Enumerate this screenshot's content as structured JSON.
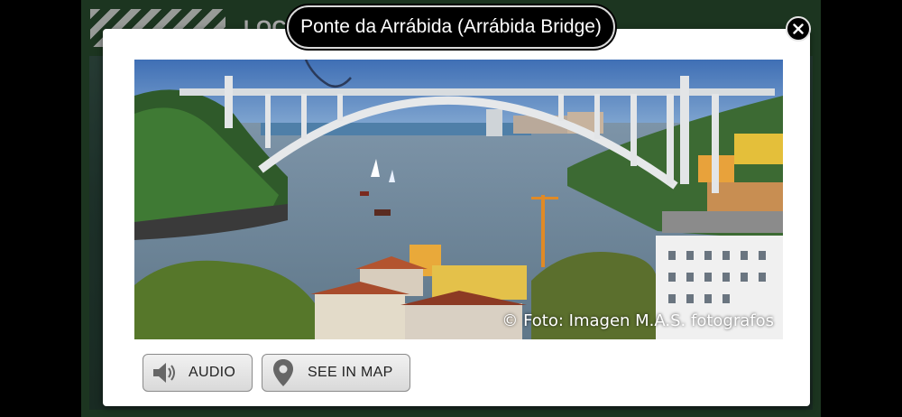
{
  "background": {
    "title": "LOC                                          NOVA DE GAIA"
  },
  "modal": {
    "title": "Ponte da Arrábida (Arrábida Bridge)",
    "photo_credit": "© Foto: Imagen M.A.S. fotografos",
    "close_icon": "close-icon"
  },
  "buttons": {
    "audio_label": "AUDIO",
    "audio_icon": "speaker-icon",
    "map_label": "SEE IN MAP",
    "map_icon": "map-pin-icon"
  },
  "colors": {
    "app_green": "#2b5232",
    "pill_bg": "#000000",
    "button_bg": "#e3e3e3"
  }
}
